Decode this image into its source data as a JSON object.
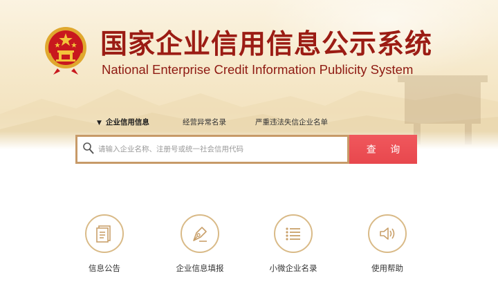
{
  "header": {
    "title_cn": "国家企业信用信息公示系统",
    "title_en": "National Enterprise Credit Information Publicity System"
  },
  "tabs": [
    {
      "label": "企业信用信息",
      "active": true
    },
    {
      "label": "经营异常名录",
      "active": false
    },
    {
      "label": "严重违法失信企业名单",
      "active": false
    }
  ],
  "search": {
    "placeholder": "请输入企业名称、注册号或统一社会信用代码",
    "value": "",
    "button_label": "查 询"
  },
  "features": [
    {
      "label": "信息公告",
      "icon": "document-icon"
    },
    {
      "label": "企业信息填报",
      "icon": "pen-nib-icon"
    },
    {
      "label": "小微企业名录",
      "icon": "list-icon"
    },
    {
      "label": "使用帮助",
      "icon": "speaker-icon"
    }
  ],
  "colors": {
    "title": "#9b1c14",
    "search_border": "#c79a68",
    "search_button": "#e8474d",
    "icon_ring": "#d9ba87",
    "icon_stroke": "#c9a06a"
  }
}
